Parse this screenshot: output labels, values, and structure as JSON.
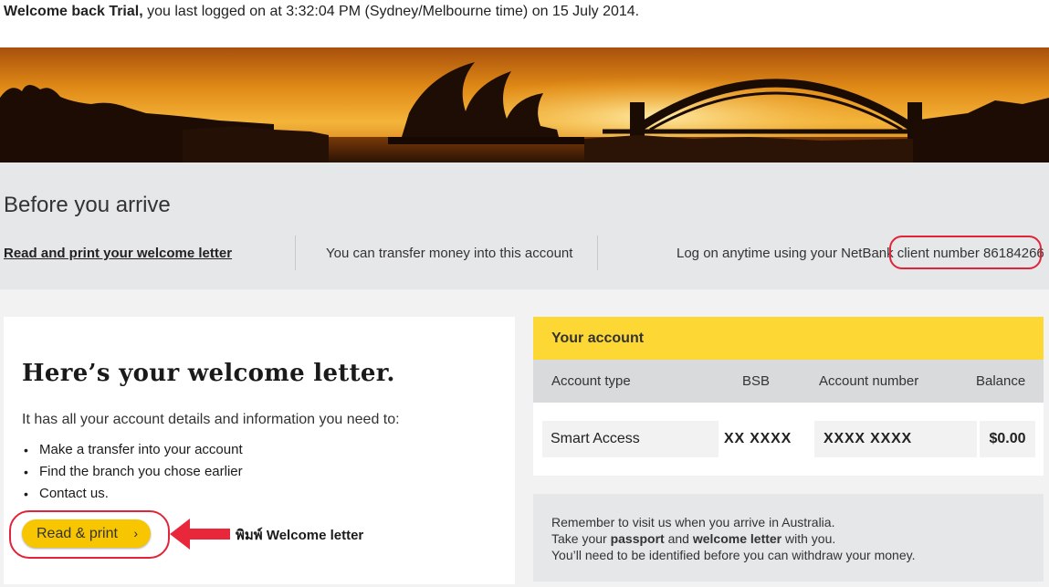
{
  "header": {
    "greeting_bold": "Welcome back Trial,",
    "greeting_rest": " you last logged on at 3:32:04 PM (Sydney/Melbourne time) on 15 July 2014."
  },
  "arrive": {
    "title": "Before you arrive",
    "welcome_letter_link": "Read and print your welcome letter",
    "transfer_text": "You can transfer money into this account",
    "logon_text": "Log on anytime using your NetBank client number 86184266"
  },
  "letter": {
    "title": "Here’s your welcome letter.",
    "intro": "It has all your account details and information you need to:",
    "items": [
      "Make a transfer into your account",
      "Find the branch you chose earlier",
      "Contact us."
    ],
    "button_label": "Read & print",
    "button_chevron": "›",
    "annotation": "พิมพ์ Welcome letter"
  },
  "account": {
    "heading": "Your account",
    "columns": [
      "Account type",
      "BSB",
      "Account number",
      "Balance"
    ],
    "row": {
      "type": "Smart Access",
      "bsb": "XX XXXX",
      "number": "XXXX XXXX",
      "balance": "$0.00"
    }
  },
  "info": {
    "line1": "Remember to visit us when you arrive in Australia.",
    "line2_pre": "Take your ",
    "line2_b1": "passport",
    "line2_mid": " and ",
    "line2_b2": "welcome letter",
    "line2_post": " with you.",
    "line3": "You’ll need to be identified before you can withdraw your money."
  },
  "colors": {
    "accent_yellow": "#fdd835",
    "button_yellow": "#f7c600",
    "highlight_red": "#e0243a"
  }
}
